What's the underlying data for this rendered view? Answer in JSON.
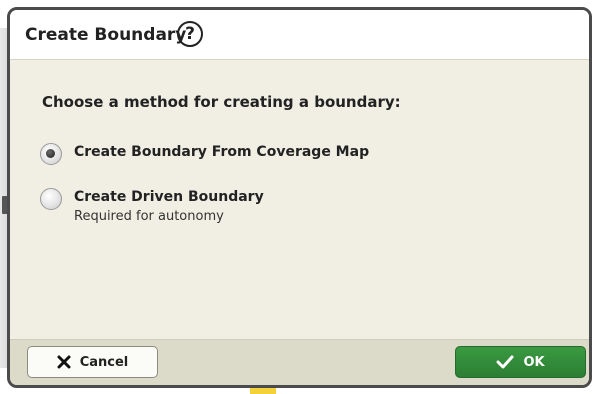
{
  "dialog": {
    "title": "Create Boundary",
    "help_icon": "question-circle-icon",
    "help_glyph": "?",
    "prompt": "Choose a method for creating a boundary:",
    "options": [
      {
        "label": "Create Boundary From Coverage Map",
        "sublabel": "",
        "selected": true
      },
      {
        "label": "Create Driven Boundary",
        "sublabel": "Required for autonomy",
        "selected": false
      }
    ]
  },
  "footer": {
    "cancel_label": "Cancel",
    "cancel_icon": "x-icon",
    "ok_label": "OK",
    "ok_icon": "checkmark-icon"
  },
  "colors": {
    "dialog_bg": "#f1efe4",
    "header_bg": "#ffffff",
    "footer_bg": "#dcdac9",
    "ok_green": "#2f8a36",
    "border": "#4b4b4b"
  }
}
